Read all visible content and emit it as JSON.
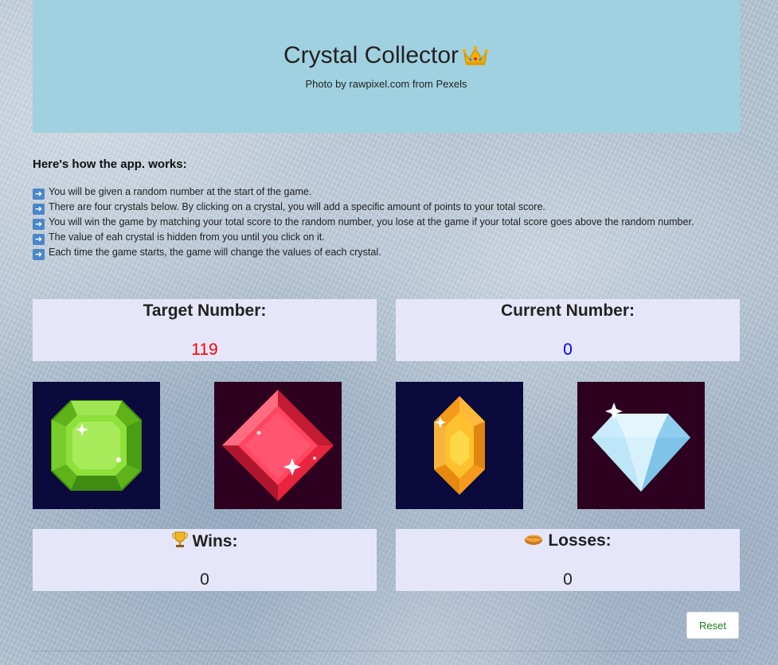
{
  "header": {
    "title": "Crystal Collector",
    "credit": "Photo by rawpixel.com from Pexels"
  },
  "instructions": {
    "title": "Here's how the app. works:",
    "items": [
      "You will be given a random number at the start of the game.",
      "There are four crystals below. By clicking on a crystal, you will add a specific amount of points to your total score.",
      "You will win the game by matching your total score to the random number, you lose at the game if your total score goes above the random number.",
      "The value of eah crystal is hidden from you until you click on it.",
      "Each time the game starts, the game will change the values of each crystal."
    ]
  },
  "scoreboard": {
    "target_label": "Target Number:",
    "target_value": "119",
    "current_label": "Current Number:",
    "current_value": "0",
    "wins_label": "Wins:",
    "wins_value": "0",
    "losses_label": "Losses:",
    "losses_value": "0"
  },
  "crystals": [
    {
      "name": "green-emerald-icon",
      "background": "#0a0a3c",
      "color": "#7ed321"
    },
    {
      "name": "red-ruby-icon",
      "background": "#2c001e",
      "color": "#ff3355"
    },
    {
      "name": "orange-topaz-icon",
      "background": "#0a0a3c",
      "color": "#ffa52a"
    },
    {
      "name": "diamond-icon",
      "background": "#2c001e",
      "color": "#bfe8fb"
    }
  ],
  "controls": {
    "reset_label": "Reset"
  },
  "colors": {
    "jumbotron": "#a0d1e0",
    "panel": "#e6e6fa",
    "target_value": "#ff0000",
    "current_value": "#0000ff",
    "reset_text": "#1b7a1b"
  }
}
